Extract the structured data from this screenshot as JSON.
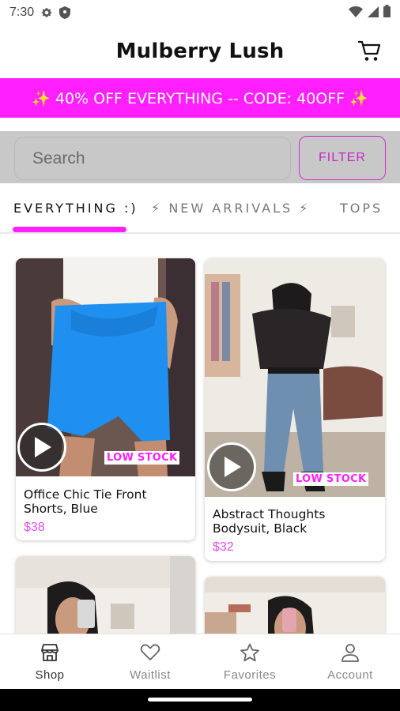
{
  "status_bar": {
    "time": "7:30",
    "left_icons": [
      "settings-gear-icon",
      "shield-icon"
    ],
    "right_icons": [
      "wifi-icon",
      "signal-icon",
      "battery-icon"
    ]
  },
  "header": {
    "title": "Mulberry Lush",
    "cart_icon": "cart-icon"
  },
  "promo": {
    "text": "✨ 40% OFF EVERYTHING -- CODE: 40OFF ✨",
    "background": "#ff1fff"
  },
  "search": {
    "placeholder": "Search",
    "value": "",
    "filter_label": "FILTER"
  },
  "tabs": [
    {
      "label": "EVERYTHING :)",
      "active": true
    },
    {
      "label": "⚡ NEW ARRIVALS ⚡",
      "active": false
    },
    {
      "label": "TOPS",
      "active": false
    }
  ],
  "products": [
    {
      "name": "Office Chic Tie Front Shorts, Blue",
      "price": "$38",
      "badge": "LOW STOCK",
      "has_video": true
    },
    {
      "name": "Abstract Thoughts Bodysuit, Black",
      "price": "$32",
      "badge": "LOW STOCK",
      "has_video": true
    },
    {
      "name": "",
      "price": "",
      "badge": "",
      "has_video": false
    },
    {
      "name": "",
      "price": "",
      "badge": "",
      "has_video": false
    }
  ],
  "bottom_nav": [
    {
      "label": "Shop",
      "icon": "storefront-icon",
      "active": true
    },
    {
      "label": "Waitlist",
      "icon": "heart-icon",
      "active": false
    },
    {
      "label": "Favorites",
      "icon": "star-icon",
      "active": false
    },
    {
      "label": "Account",
      "icon": "person-icon",
      "active": false
    }
  ],
  "colors": {
    "accent": "#ff1fff",
    "price": "#e14fe8",
    "filter_border": "#d02cd0"
  }
}
